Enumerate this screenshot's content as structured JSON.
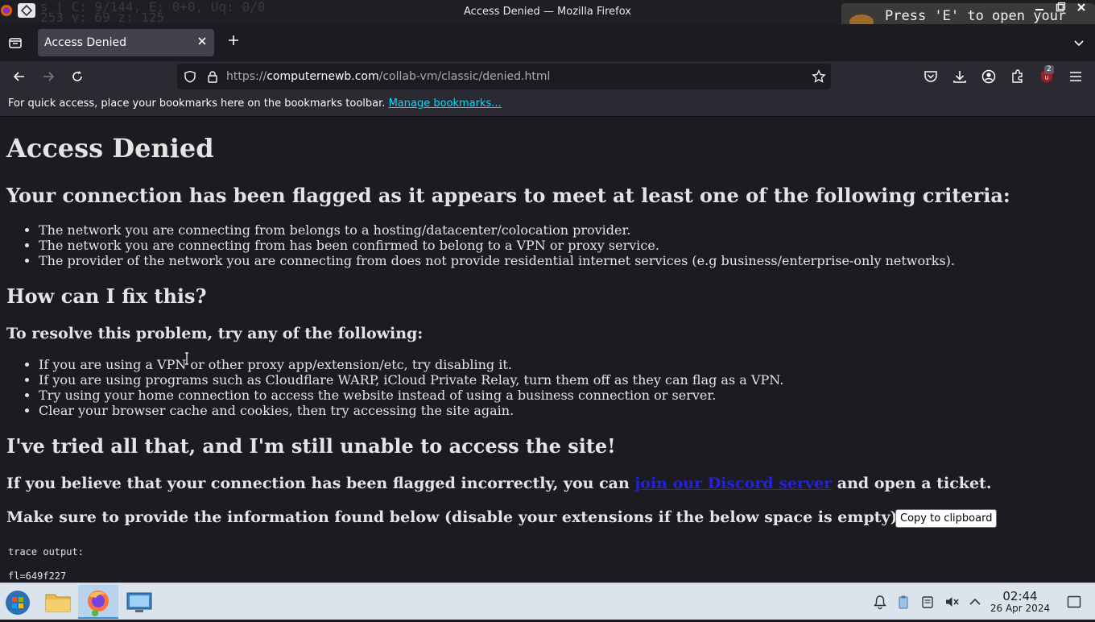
{
  "window": {
    "title": "Access Denied — Mozilla Firefox",
    "background_ghost_text": [
      "s | C: 9/144, E: 0+0, Uq: 0/0",
      "   253 y: 69 z: 125"
    ],
    "game_overlay_text": "Press 'E' to open your"
  },
  "tabs": [
    {
      "label": "Access Denied"
    }
  ],
  "navigation": {
    "url_prefix": "https://",
    "url_domain": "computernewb.com",
    "url_path": "/collab-vm/classic/denied.html",
    "extension_badge": "2"
  },
  "bookmarks_bar": {
    "text": "For quick access, place your bookmarks here on the bookmarks toolbar. ",
    "link": "Manage bookmarks..."
  },
  "page": {
    "title": "Access Denied",
    "criteria_heading": "Your connection has been flagged as it appears to meet at least one of the following criteria:",
    "criteria": [
      "The network you are connecting from belongs to a hosting/datacenter/colocation provider.",
      "The network you are connecting from has been confirmed to belong to a VPN or proxy service.",
      "The provider of the network you are connecting from does not provide residential internet services (e.g business/enterprise-only networks)."
    ],
    "fix_heading": "How can I fix this?",
    "resolve_heading": "To resolve this problem, try any of the following:",
    "fixes": [
      "If you are using a VPN or other proxy app/extension/etc, try disabling it.",
      "If you are using programs such as Cloudflare WARP, iCloud Private Relay, turn them off as they can flag as a VPN.",
      "Try using your home connection to access the website instead of using a business connection or server.",
      "Clear your browser cache and cookies, then try accessing the site again."
    ],
    "still_heading": "I've tried all that, and I'm still unable to access the site!",
    "discord_before": "If you believe that your connection has been flagged incorrectly, you can ",
    "discord_link": "join our Discord server",
    "discord_after": " and open a ticket.",
    "provide_heading": "Make sure to provide the information found below (disable your extensions if the below space is empty):",
    "copy_button": "Copy to clipboard",
    "trace_label": "trace output:",
    "trace_line1": "fl=649f227"
  },
  "taskbar": {
    "time": "02:44",
    "date": "26 Apr 2024"
  },
  "colors": {
    "page_background": "#1c1b22",
    "toolbar": "#2b2a33",
    "link_cyan": "#00ddff",
    "discord_link": "#2222dd",
    "taskbar": "#dbe4ec"
  }
}
